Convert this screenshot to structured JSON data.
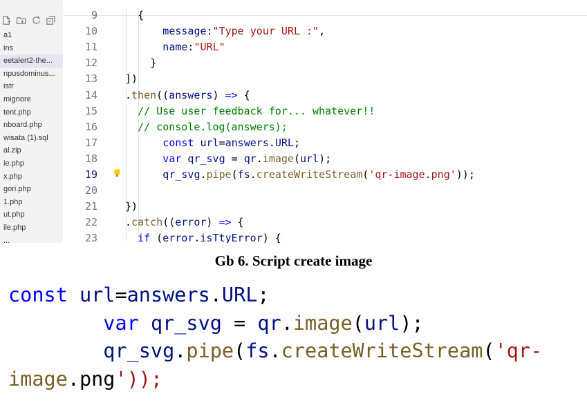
{
  "explorer": {
    "toolbar_icons": [
      "new-file-icon",
      "new-folder-icon",
      "refresh-icon",
      "collapse-all-icon"
    ],
    "files": [
      "a1",
      "ins",
      "eetalert2-the...",
      "npusdominus...",
      "istr",
      "mignore",
      "tent.php",
      "nboard.php",
      "wisata (1).sql",
      "al.zip",
      "ie.php",
      "x.php",
      "gori.php",
      "1.php",
      "ut.php",
      "ile.php",
      "..."
    ],
    "selected_index": 2
  },
  "editor": {
    "lines": [
      {
        "num": "9",
        "code": "{"
      },
      {
        "num": "10",
        "code": "message:\"Type your URL :\","
      },
      {
        "num": "11",
        "code": "name:\"URL\""
      },
      {
        "num": "12",
        "code": "}"
      },
      {
        "num": "13",
        "code": "])"
      },
      {
        "num": "14",
        "code": ".then((answers) => {"
      },
      {
        "num": "15",
        "code": "// Use user feedback for... whatever!!"
      },
      {
        "num": "16",
        "code": "// console.log(answers);"
      },
      {
        "num": "17",
        "code": "const url=answers.URL;"
      },
      {
        "num": "18",
        "code": "var qr_svg = qr.image(url);"
      },
      {
        "num": "19",
        "code": "qr_svg.pipe(fs.createWriteStream('qr-image.png'));"
      },
      {
        "num": "20",
        "code": ""
      },
      {
        "num": "21",
        "code": "})"
      },
      {
        "num": "22",
        "code": ".catch((error) => {"
      },
      {
        "num": "23",
        "code": "if (error.isTtyError) {"
      }
    ],
    "active_line": "19",
    "lightbulb_icon": "lightbulb-icon"
  },
  "caption": "Gb 6. Script create image",
  "enlarged_code": [
    "const url=answers.URL;",
    "        var qr_svg = qr.image(url);",
    "        qr_svg.pipe(fs.createWriteStream('qr-",
    "image.png'));"
  ],
  "colors": {
    "string": "#a31515",
    "keyword": "#0000ff",
    "function": "#795e26",
    "variable": "#001080",
    "comment": "#008000"
  }
}
